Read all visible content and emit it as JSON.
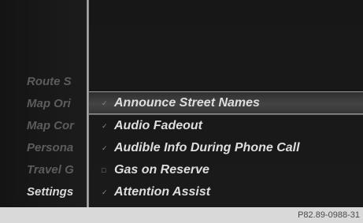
{
  "menu": {
    "items": [
      {
        "label": "Route S",
        "active": false
      },
      {
        "label": "Map Ori",
        "active": false
      },
      {
        "label": "Map Cor",
        "active": false
      },
      {
        "label": "Persona",
        "active": false
      },
      {
        "label": "Travel G",
        "active": false
      },
      {
        "label": "Settings",
        "active": true
      }
    ]
  },
  "options": [
    {
      "label": "Announce Street Names",
      "checked": true,
      "highlighted": true
    },
    {
      "label": "Audio Fadeout",
      "checked": true,
      "highlighted": false
    },
    {
      "label": "Audible Info During Phone Call",
      "checked": true,
      "highlighted": false
    },
    {
      "label": "Gas on Reserve",
      "checked": false,
      "highlighted": false
    },
    {
      "label": "Attention Assist",
      "checked": true,
      "highlighted": false
    }
  ],
  "icons": {
    "checked": "checkmark-icon",
    "unchecked": "empty-checkbox-icon"
  },
  "caption": "P82.89-0988-31"
}
